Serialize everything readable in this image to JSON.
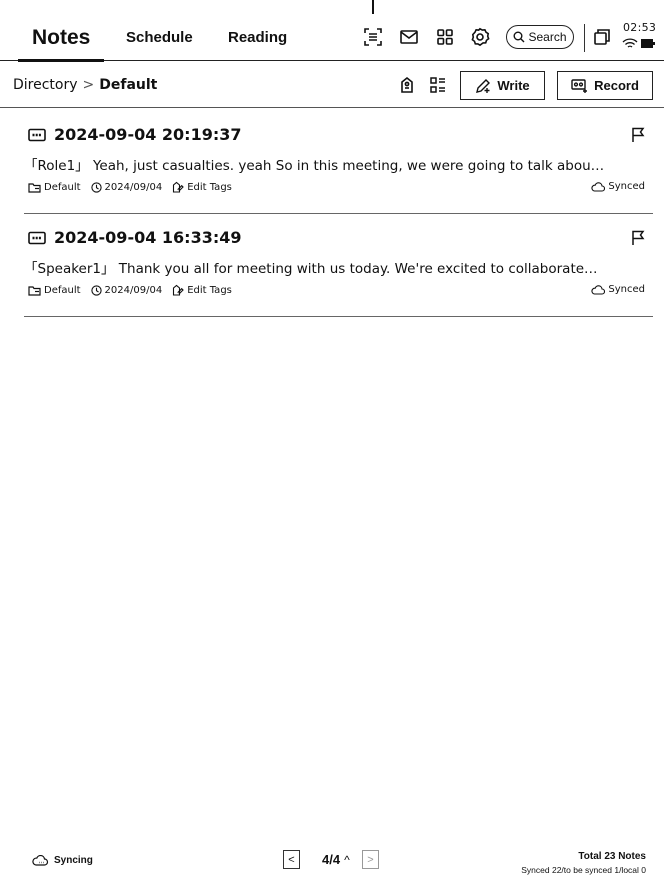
{
  "tabs": [
    {
      "label": "Notes",
      "active": true
    },
    {
      "label": "Schedule",
      "active": false
    },
    {
      "label": "Reading",
      "active": false
    }
  ],
  "topbar": {
    "icons": [
      "scan-text-icon",
      "mail-icon",
      "apps-grid-icon",
      "settings-gear-icon"
    ],
    "search_label": "Search",
    "window_icon": "window-switch-icon",
    "time": "02:53"
  },
  "breadcrumb": {
    "root": "Directory",
    "separator": ">",
    "current": "Default"
  },
  "subbar": {
    "icons": [
      "tag-icon",
      "list-view-icon"
    ],
    "write_label": "Write",
    "record_label": "Record"
  },
  "notes": [
    {
      "title": "2024-09-04 20:19:37",
      "excerpt": "「Role1」 Yeah, just casualties. yeah So in this meeting, we were going to talk abou…",
      "folder": "Default",
      "date": "2024/09/04",
      "tags_label": "Edit Tags",
      "sync_status": "Synced"
    },
    {
      "title": "2024-09-04 16:33:49",
      "excerpt": "「Speaker1」 Thank you all for meeting with us today. We're excited to collaborate…",
      "folder": "Default",
      "date": "2024/09/04",
      "tags_label": "Edit Tags",
      "sync_status": "Synced"
    }
  ],
  "footer": {
    "sync_status": "Syncing",
    "prev_symbol": "<",
    "next_symbol": ">",
    "page": "4/4",
    "page_caret": "^",
    "total": "Total 23 Notes",
    "sync_counts": "Synced 22/to be synced 1/local 0"
  },
  "colors": {
    "ink": "#111111",
    "background": "#ffffff",
    "divider": "#666666",
    "disabled": "#999999"
  }
}
